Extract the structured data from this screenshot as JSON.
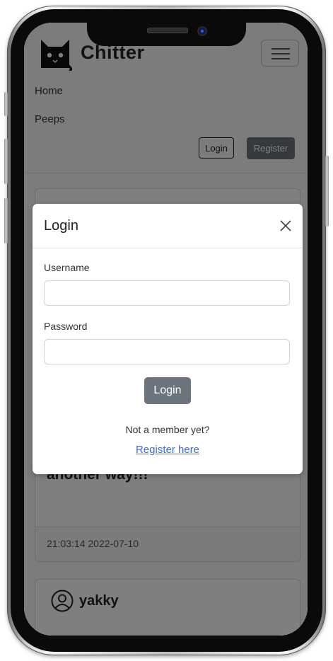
{
  "header": {
    "brand": "Chitter",
    "nav": [
      {
        "label": "Home"
      },
      {
        "label": "Peeps"
      }
    ],
    "login_button": "Login",
    "register_button": "Register"
  },
  "feed": {
    "peeps": [
      {
        "text": "another way!!!",
        "timestamp": "21:03:14 2022-07-10"
      }
    ],
    "next_author": "yakky"
  },
  "modal": {
    "title": "Login",
    "username_label": "Username",
    "username_value": "",
    "password_label": "Password",
    "password_value": "",
    "submit_label": "Login",
    "prompt": "Not a member yet?",
    "register_link": "Register here"
  },
  "icons": {
    "logo": "cat-logo-icon",
    "menu": "hamburger-menu-icon",
    "close": "close-icon",
    "avatar": "user-circle-icon"
  },
  "colors": {
    "button_secondary": "#6c757d",
    "link": "#3d6fd1",
    "backdrop": "rgba(0,0,0,0.5)"
  }
}
